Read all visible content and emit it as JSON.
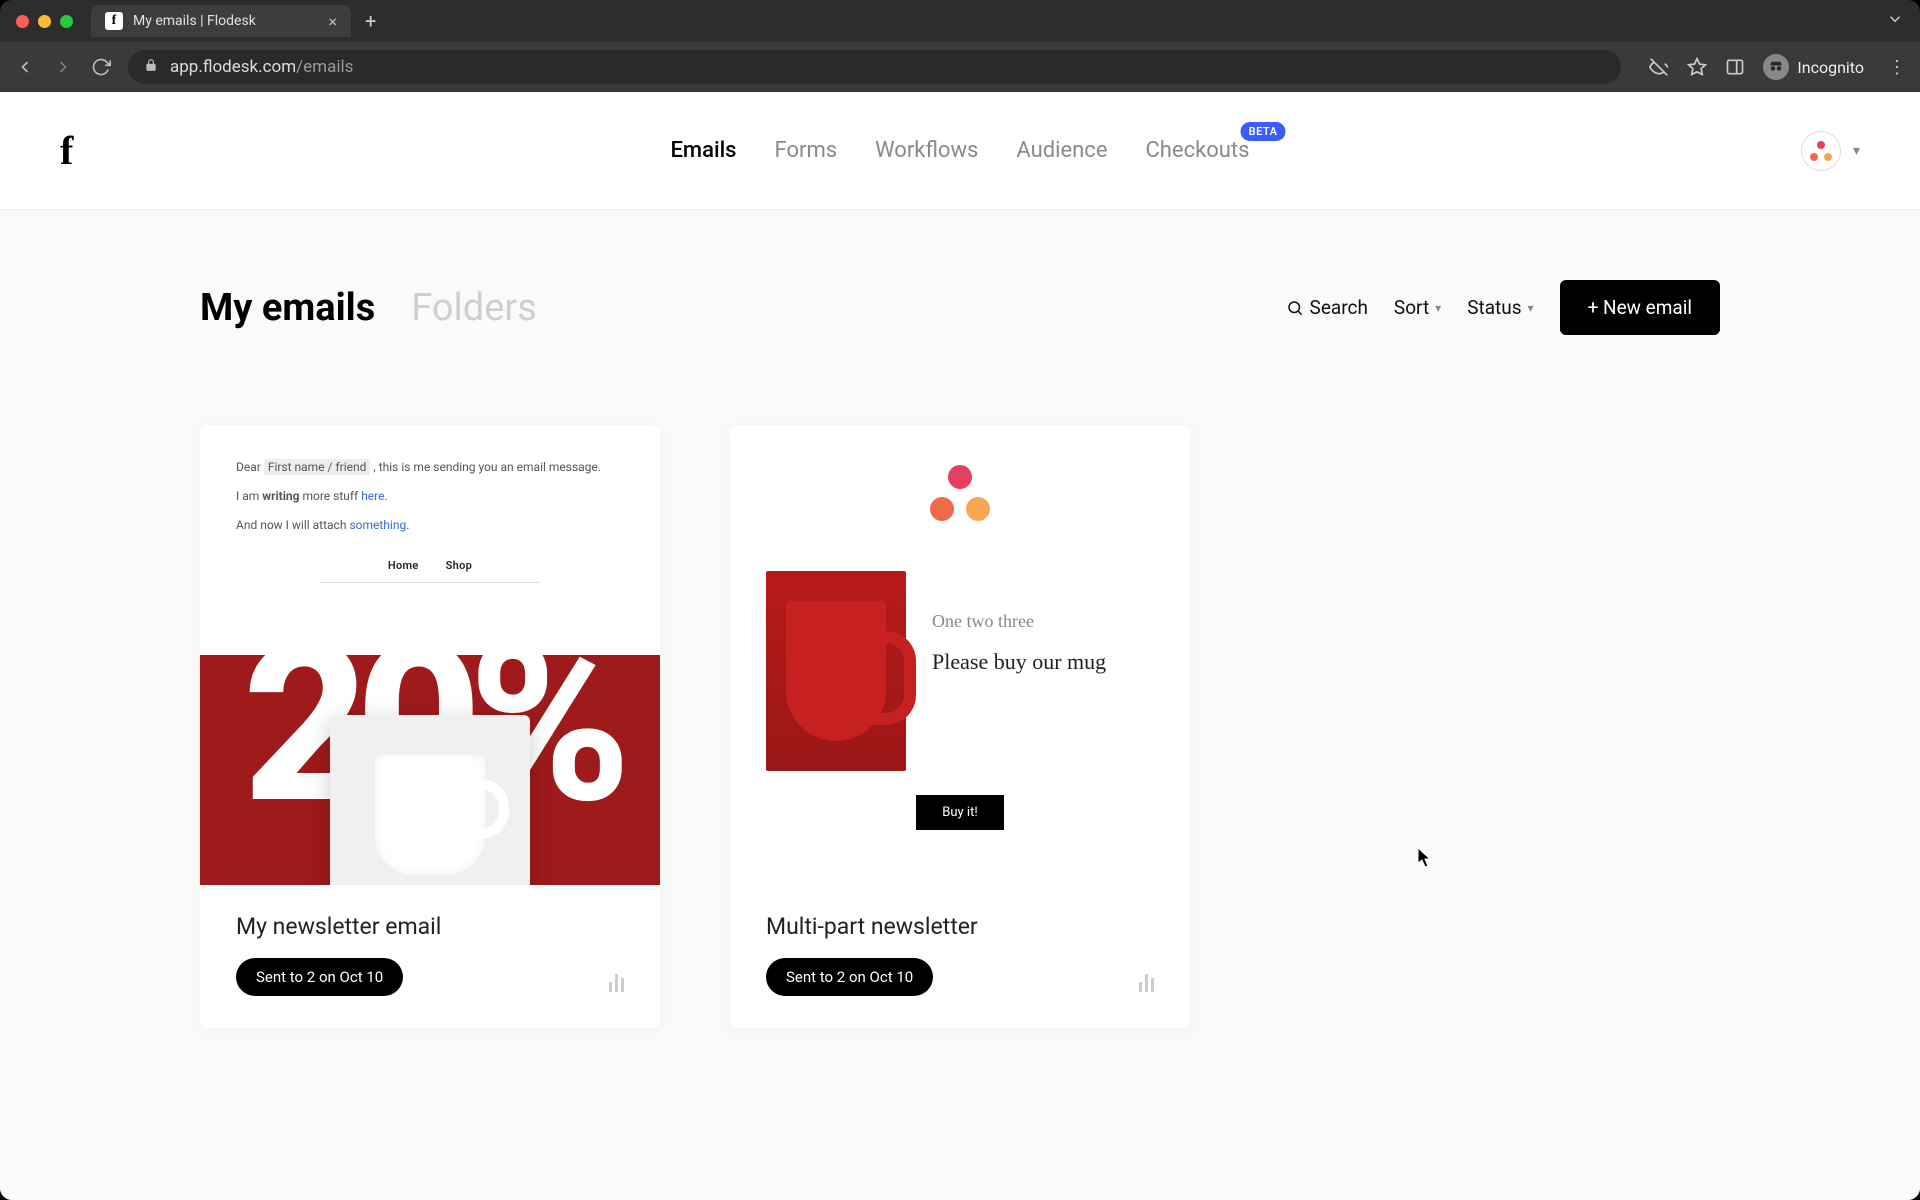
{
  "browser": {
    "tab_title": "My emails | Flodesk",
    "url_host": "app.flodesk.com",
    "url_path": "/emails",
    "incognito_label": "Incognito"
  },
  "nav": {
    "items": [
      {
        "label": "Emails",
        "active": true
      },
      {
        "label": "Forms",
        "active": false
      },
      {
        "label": "Workflows",
        "active": false
      },
      {
        "label": "Audience",
        "active": false
      },
      {
        "label": "Checkouts",
        "active": false,
        "badge": "BETA"
      }
    ]
  },
  "page": {
    "tabs": {
      "primary": "My emails",
      "secondary": "Folders"
    },
    "toolbar": {
      "search": "Search",
      "sort": "Sort",
      "status": "Status",
      "new_email": "+ New email"
    }
  },
  "emails": [
    {
      "title": "My newsletter email",
      "status": "Sent to 2 on Oct 10",
      "preview": {
        "greeting_prefix": "Dear ",
        "merge_field": "First name / friend",
        "greeting_suffix": " , this is me sending you an email message.",
        "line2_a": "I am ",
        "line2_b": "writing",
        "line2_c": " more stuff ",
        "line2_link": "here",
        "line2_d": ".",
        "line3_a": "And now I will attach ",
        "line3_link": "something",
        "line3_b": ".",
        "nav_home": "Home",
        "nav_shop": "Shop"
      }
    },
    {
      "title": "Multi-part newsletter",
      "status": "Sent to 2 on Oct 10",
      "preview": {
        "script": "One two three",
        "headline": "Please buy our mug",
        "cta": "Buy it!"
      }
    }
  ]
}
